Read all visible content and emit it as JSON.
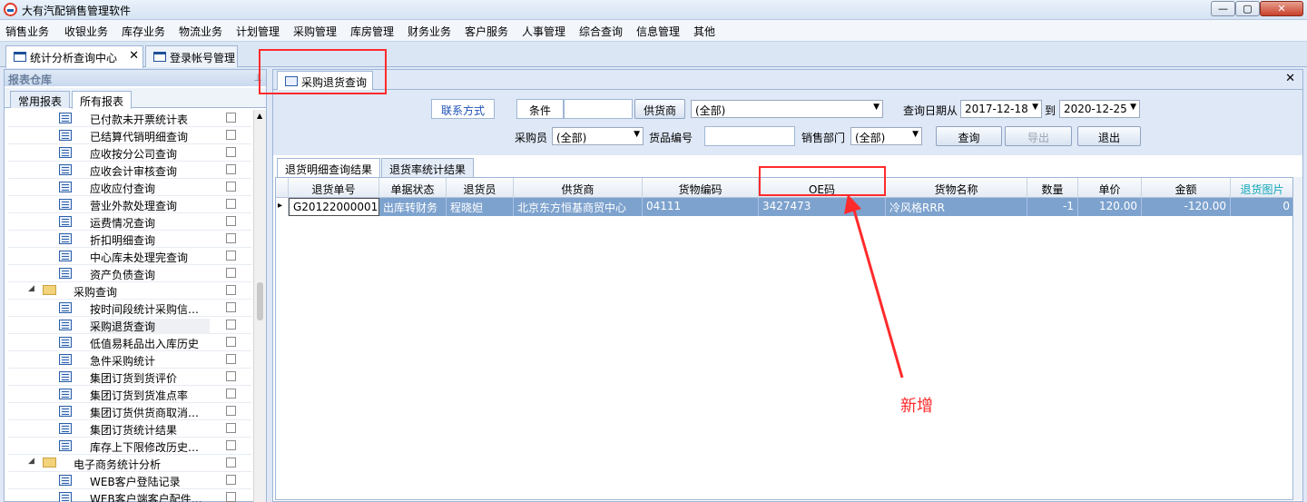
{
  "window": {
    "title": "大有汽配销售管理软件",
    "min_label": "—",
    "max_label": "▢",
    "close_label": "✕"
  },
  "menu": [
    "销售业务",
    "收银业务",
    "库存业务",
    "物流业务",
    "计划管理",
    "采购管理",
    "库房管理",
    "财务业务",
    "客户服务",
    "人事管理",
    "综合查询",
    "信息管理",
    "其他"
  ],
  "doc_tabs": [
    {
      "label": "统计分析查询中心",
      "close": "✕"
    },
    {
      "label": "登录帐号管理"
    }
  ],
  "left_panel": {
    "title": "报表仓库",
    "pin": "⊥",
    "tabs": [
      "常用报表",
      "所有报表"
    ],
    "items": [
      {
        "label": "已付款未开票统计表",
        "type": "report"
      },
      {
        "label": "已结算代销明细查询",
        "type": "report"
      },
      {
        "label": "应收按分公司查询",
        "type": "report"
      },
      {
        "label": "应收会计审核查询",
        "type": "report"
      },
      {
        "label": "应收应付查询",
        "type": "report"
      },
      {
        "label": "营业外款处理查询",
        "type": "report"
      },
      {
        "label": "运费情况查询",
        "type": "report"
      },
      {
        "label": "折扣明细查询",
        "type": "report"
      },
      {
        "label": "中心库未处理完查询",
        "type": "report"
      },
      {
        "label": "资产负债查询",
        "type": "report"
      },
      {
        "label": "采购查询",
        "type": "folder"
      },
      {
        "label": "按时间段统计采购信…",
        "type": "report"
      },
      {
        "label": "采购退货查询",
        "type": "report",
        "selected": true
      },
      {
        "label": "低值易耗品出入库历史",
        "type": "report"
      },
      {
        "label": "急件采购统计",
        "type": "report"
      },
      {
        "label": "集团订货到货评价",
        "type": "report"
      },
      {
        "label": "集团订货到货准点率",
        "type": "report"
      },
      {
        "label": "集团订货供货商取消…",
        "type": "report"
      },
      {
        "label": "集团订货统计结果",
        "type": "report"
      },
      {
        "label": "库存上下限修改历史…",
        "type": "report"
      },
      {
        "label": "电子商务统计分析",
        "type": "folder"
      },
      {
        "label": "WEB客户登陆记录",
        "type": "report"
      },
      {
        "label": "WEB客户端客户配件…",
        "type": "report"
      }
    ]
  },
  "right_panel": {
    "tab_label": "采购退货查询",
    "close": "✕",
    "form": {
      "contact_btn": "联系方式",
      "condition_label": "条件",
      "condition_value": "",
      "supplier_label": "供货商",
      "supplier_value": "(全部)",
      "date_label": "查询日期从",
      "date_from": "2017-12-18",
      "date_to_label": "到",
      "date_to": "2020-12-25",
      "buyer_label": "采购员",
      "buyer_value": "(全部)",
      "item_code_label": "货品编号",
      "item_code_value": "",
      "dept_label": "销售部门",
      "dept_value": "(全部)",
      "query_btn": "查询",
      "export_btn": "导出",
      "exit_btn": "退出"
    },
    "result_tabs": [
      "退货明细查询结果",
      "退货率统计结果"
    ],
    "columns": [
      "退货单号",
      "单据状态",
      "退货员",
      "供货商",
      "货物编码",
      "OE码",
      "货物名称",
      "数量",
      "单价",
      "金额",
      "退货图片"
    ],
    "rows": [
      [
        "G20122000001",
        "出库转财务",
        "程晓妲",
        "北京东方恒基商贸中心",
        "04111",
        "3427473",
        "冷风格RRR",
        "-1",
        "120.00",
        "-120.00",
        "0"
      ]
    ],
    "row_indicator": "▸"
  },
  "annotation": {
    "label": "新增",
    "color": "#ff2b2b"
  }
}
